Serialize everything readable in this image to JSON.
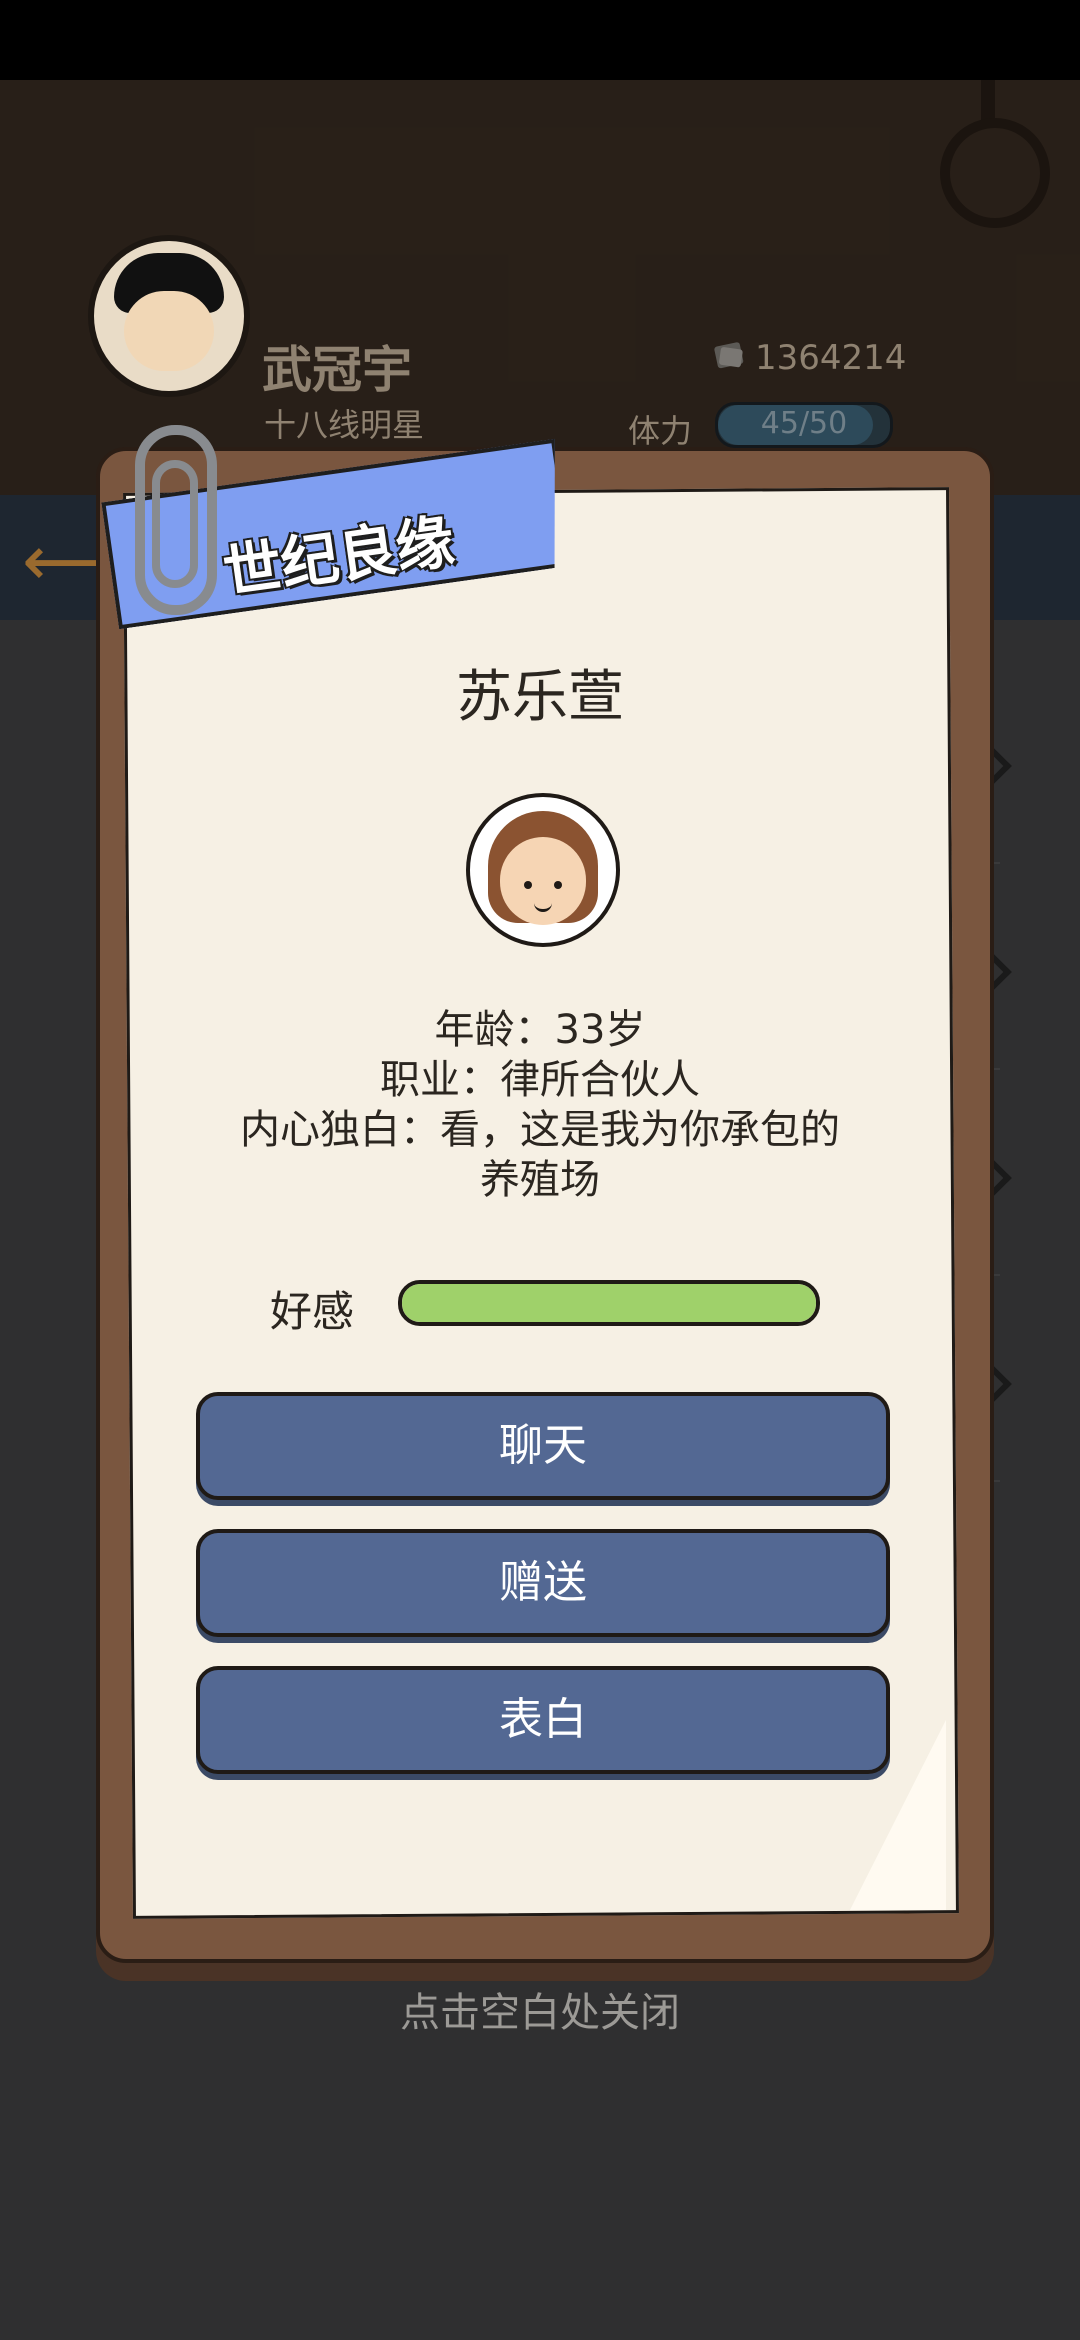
{
  "background": {
    "player_name": "武冠宇",
    "player_title": "十八线明星",
    "money": "1364214",
    "stamina_label": "体力",
    "stamina_value": "45/50",
    "stamina_fraction": 0.9
  },
  "dialog": {
    "banner": "世纪良缘",
    "character_name": "苏乐萱",
    "age_line": "年龄：33岁",
    "job_line": "职业：律所合伙人",
    "monologue_line1": "内心独白：看，这是我为你承包的",
    "monologue_line2": "养殖场",
    "affinity_label": "好感",
    "affinity_fraction": 1.0,
    "buttons": {
      "chat": "聊天",
      "gift": "赠送",
      "confess": "表白"
    }
  },
  "close_hint": "点击空白处关闭",
  "colors": {
    "button": "#536893",
    "banner": "#7f9ef1",
    "affinity": "#9fd16a",
    "board": "#7a563f",
    "paper": "#f6f0e4"
  }
}
